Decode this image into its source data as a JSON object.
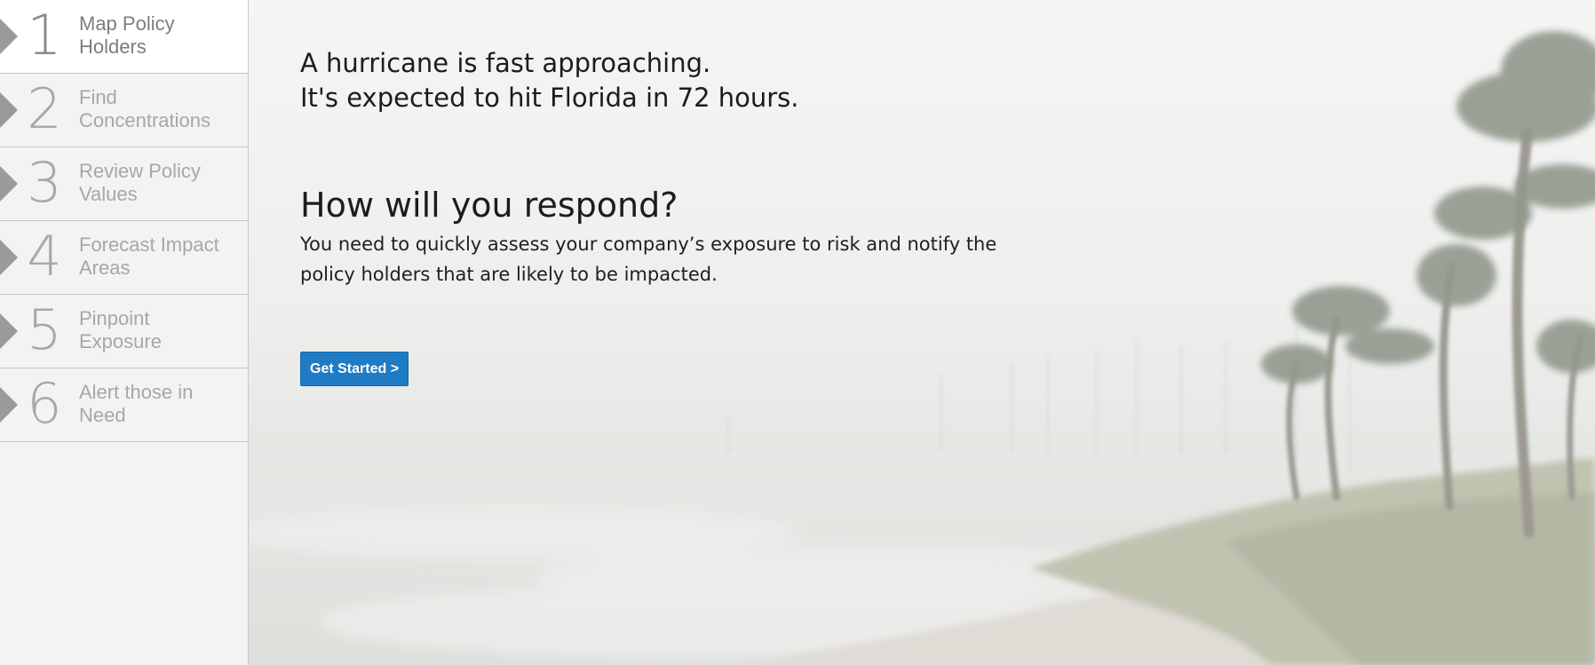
{
  "sidebar": {
    "steps": [
      {
        "number": "1",
        "label_line1": "Map Policy",
        "label_line2": "Holders"
      },
      {
        "number": "2",
        "label_line1": "Find",
        "label_line2": "Concentrations"
      },
      {
        "number": "3",
        "label_line1": "Review Policy",
        "label_line2": "Values"
      },
      {
        "number": "4",
        "label_line1": "Forecast Impact",
        "label_line2": "Areas"
      },
      {
        "number": "5",
        "label_line1": "Pinpoint",
        "label_line2": "Exposure"
      },
      {
        "number": "6",
        "label_line1": "Alert those in",
        "label_line2": "Need"
      }
    ],
    "active_step": 1
  },
  "hero": {
    "headline_line1": "A hurricane is fast approaching.",
    "headline_line2": "It's expected to hit Florida in 72 hours.",
    "question": "How will you respond?",
    "body_line1": "You need to quickly assess your company’s exposure to risk and notify the",
    "body_line2": "policy holders that are likely to be impacted.",
    "cta_label": "Get Started >"
  },
  "colors": {
    "button": "#1f7bc4",
    "sidebar_bg": "#f3f3f3",
    "active_step_bg": "#ffffff"
  }
}
